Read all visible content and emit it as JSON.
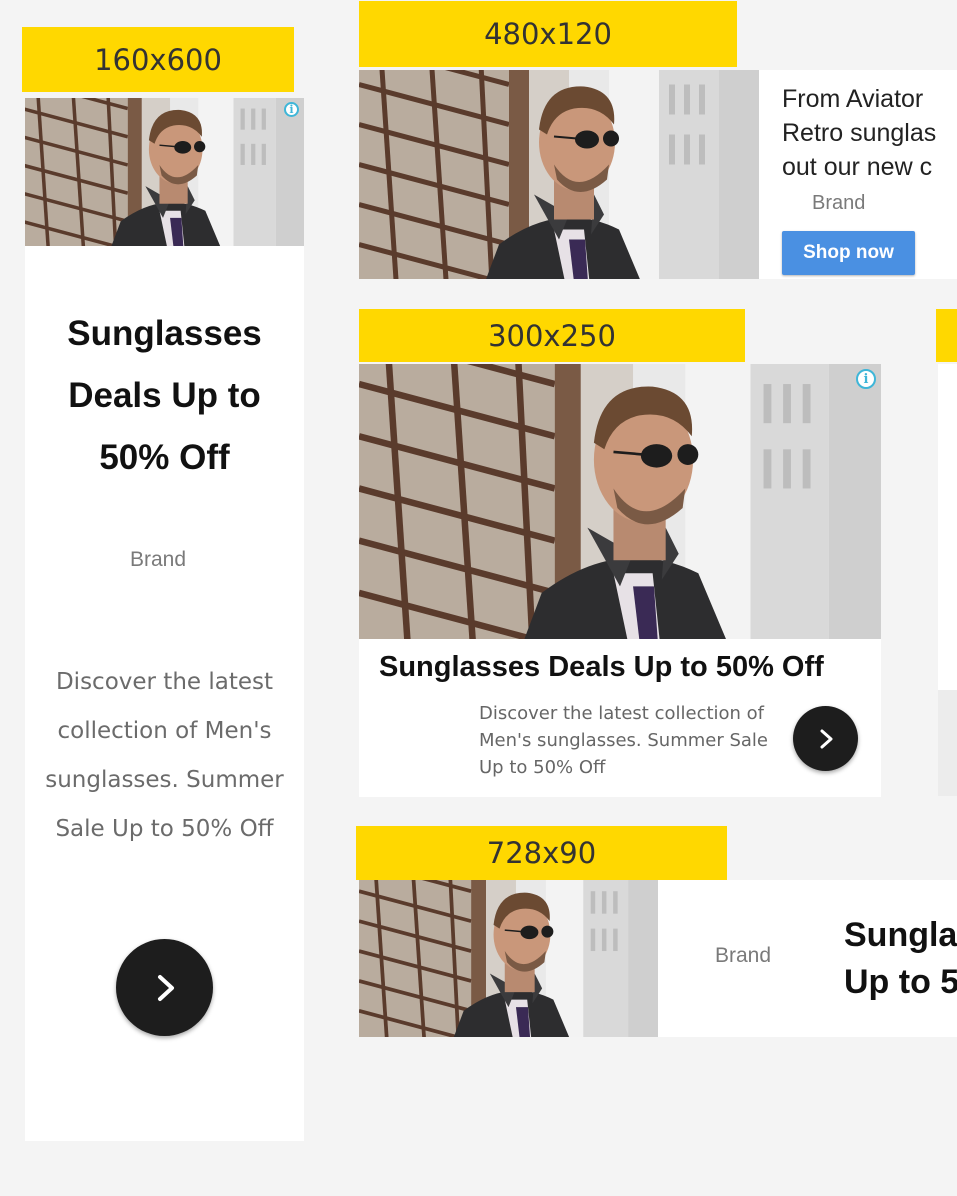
{
  "labels": {
    "skyscraper": "160x600",
    "banner": "480x120",
    "rectangle": "300x250",
    "leaderboard": "728x90"
  },
  "ad": {
    "headline": "Sunglasses Deals Up to 50% Off",
    "brand": "Brand",
    "description": "Discover the latest collection of Men's sunglasses. Summer Sale Up to 50% Off",
    "banner_text_lines": [
      "From Aviator",
      "Retro sunglas",
      "out our new c"
    ],
    "cta_label": "Shop now",
    "leaderboard_headline_lines": [
      "Sungla",
      "Up to 5"
    ]
  },
  "colors": {
    "label_bg": "#ffd800",
    "cta_bg": "#4a90e2",
    "arrow_bg": "#1d1d1d",
    "page_bg": "#f4f4f4",
    "info_icon": "#3fb6d8"
  },
  "icons": {
    "info": "info-icon",
    "arrow": "chevron-right-icon"
  }
}
